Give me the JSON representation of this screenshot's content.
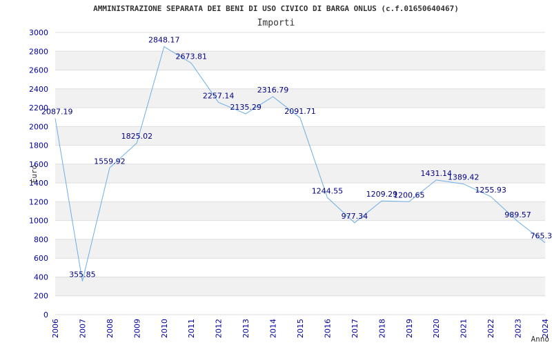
{
  "chart_data": {
    "type": "line",
    "title": "AMMINISTRAZIONE SEPARATA DEI BENI DI USO CIVICO DI BARGA ONLUS (c.f.01650640467)",
    "subtitle": "Importi",
    "xlabel": "Anno",
    "ylabel": "Euro",
    "ylim": [
      0,
      3000
    ],
    "yticks": [
      0,
      200,
      400,
      600,
      800,
      1000,
      1200,
      1400,
      1600,
      1800,
      2000,
      2200,
      2400,
      2600,
      2800,
      3000
    ],
    "categories": [
      "2006",
      "2007",
      "2008",
      "2009",
      "2010",
      "2011",
      "2012",
      "2013",
      "2014",
      "2015",
      "2016",
      "2017",
      "2018",
      "2019",
      "2020",
      "2021",
      "2022",
      "2023",
      "2024"
    ],
    "series": [
      {
        "values": [
          2087.19,
          355.85,
          1559.92,
          1825.02,
          2848.17,
          2673.81,
          2257.14,
          2135.29,
          2316.79,
          2091.71,
          1244.55,
          977.34,
          1209.29,
          1200.65,
          1431.14,
          1389.42,
          1255.93,
          989.57,
          765.3
        ],
        "labels": [
          "2087.19",
          "355.85",
          "1559.92",
          "1825.02",
          "2848.17",
          "2673.81",
          "2257.14",
          "2135.29",
          "2316.79",
          "2091.71",
          "1244.55",
          "977.34",
          "1209.29",
          "1200.65",
          "1431.14",
          "1389.42",
          "1255.93",
          "989.57",
          "765.3"
        ]
      }
    ],
    "grid": true,
    "colors": {
      "line": "#6aaee8",
      "band": "#f1f1f1",
      "axis_text": "#0000a0",
      "label_text": "#000080",
      "title_text": "#333333"
    }
  }
}
